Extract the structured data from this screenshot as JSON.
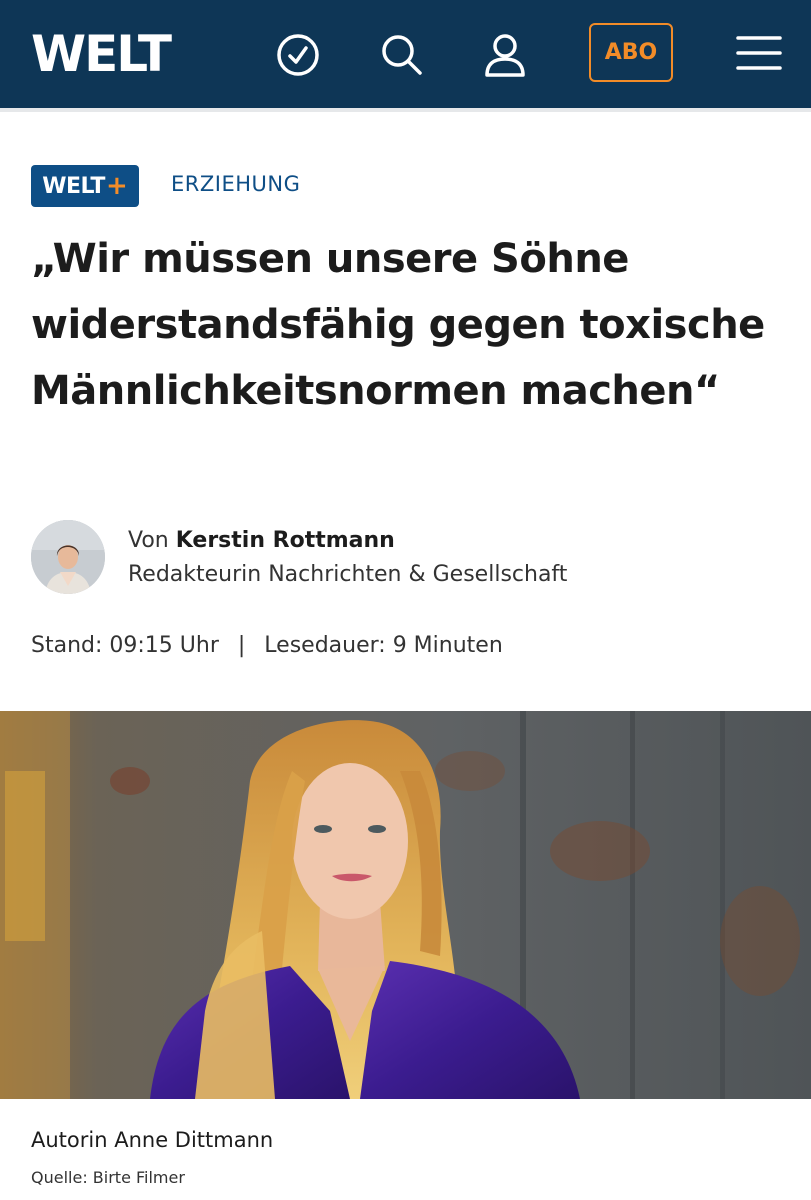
{
  "header": {
    "logo_text": "WELT",
    "abo_label": "ABO",
    "background_color": "#0e3656",
    "accent_color": "#f28c28",
    "icons": [
      "history-clock-icon",
      "search-icon",
      "user-account-icon",
      "hamburger-menu-icon"
    ]
  },
  "article": {
    "badge": {
      "text": "WELT",
      "plus": "+"
    },
    "category": "ERZIEHUNG",
    "headline": "„Wir müssen unsere Söhne widerstandsfähig gegen toxische Männlichkeitsnormen machen“",
    "author": {
      "prefix": "Von",
      "name": "Kerstin Rottmann",
      "role": "Redakteurin Nachrichten & Gesellschaft"
    },
    "meta": {
      "stand": "Stand: 09:15 Uhr",
      "separator": "|",
      "reading_time": "Lesedauer: 9 Minuten"
    },
    "image": {
      "caption": "Autorin Anne Dittmann",
      "source": "Quelle: Birte Filmer"
    }
  }
}
